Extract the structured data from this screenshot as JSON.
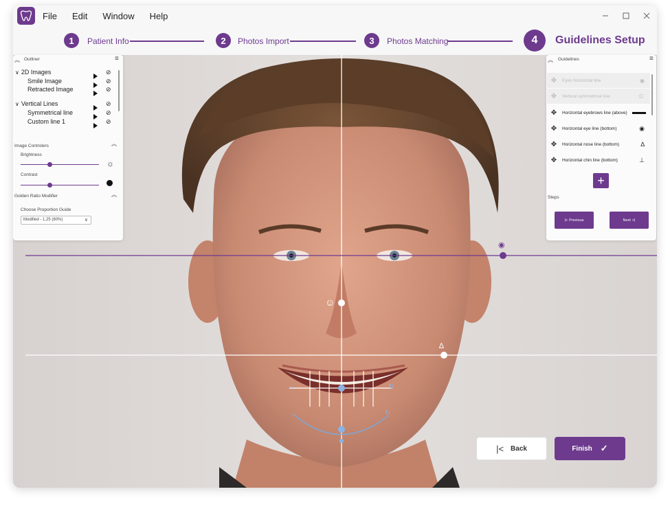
{
  "menu": [
    "File",
    "Edit",
    "Window",
    "Help"
  ],
  "window_controls": [
    "minimize-icon",
    "maximize-icon",
    "close-icon"
  ],
  "stepper": {
    "steps": [
      {
        "num": "1",
        "label": "Patient Info"
      },
      {
        "num": "2",
        "label": "Photos Import"
      },
      {
        "num": "3",
        "label": "Photos Matching"
      },
      {
        "num": "4",
        "label": "Guidelines Setup"
      }
    ],
    "active_index": 3
  },
  "outliner": {
    "title": "Outliner",
    "groups": [
      {
        "label": "2D Images",
        "children": [
          "Smile Image",
          "Retracted Image"
        ]
      },
      {
        "label": "Vertical Lines",
        "children": [
          "Symmetrical line",
          "Custom line 1"
        ]
      }
    ],
    "image_controllers_title": "Image Controlers",
    "brightness_label": "Brightness",
    "brightness_value": 0.37,
    "contrast_label": "Contrast",
    "contrast_value": 0.37,
    "golden_ratio_title": "Golden Ratio Modifier",
    "proportion_label": "Choose Proportion Guide",
    "proportion_value": "Modified - 1.25 (80%)"
  },
  "guidelines": {
    "title": "Guidelines",
    "items": [
      {
        "label": "Eyes horizontal line",
        "disabled": true
      },
      {
        "label": "Vertical symmetrical line",
        "disabled": true
      },
      {
        "label": "Horizontal eyebrows line (above)",
        "disabled": false
      },
      {
        "label": "Horizontal eye line (bottom)",
        "disabled": false
      },
      {
        "label": "Horizontal nose line (bottom)",
        "disabled": false
      },
      {
        "label": "Horizontal chin line (bottom)",
        "disabled": false
      }
    ],
    "steps_label": "Steps",
    "previous_label": "Previous",
    "next_label": "Next"
  },
  "footer": {
    "back_label": "Back",
    "finish_label": "Finish"
  },
  "colors": {
    "accent": "#6d3a8e"
  }
}
